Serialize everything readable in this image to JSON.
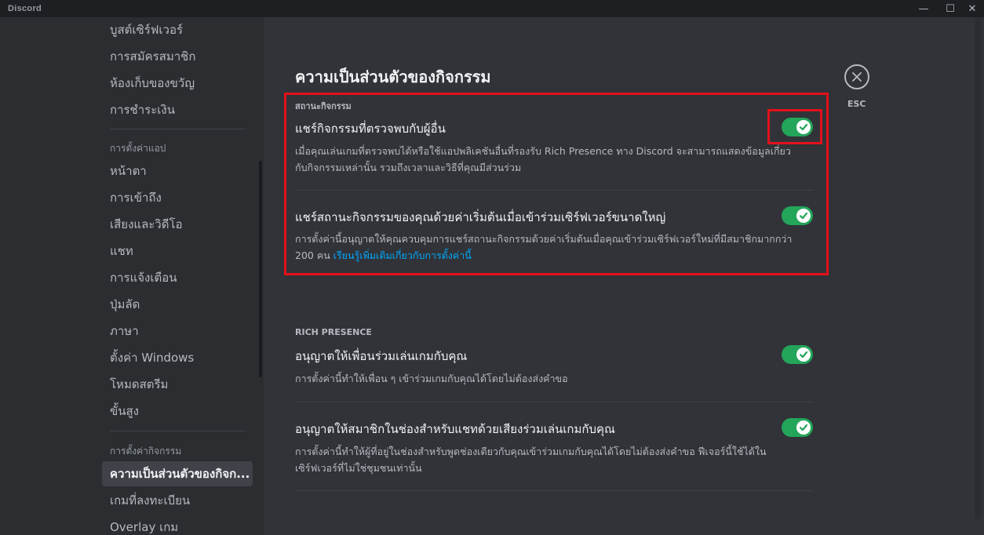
{
  "window": {
    "title": "Discord",
    "controls": {
      "minimize": "—",
      "maximize": "☐",
      "close": "✕"
    }
  },
  "sidebar": {
    "top_items": [
      {
        "label": "บูสต์เซิร์ฟเวอร์"
      },
      {
        "label": "การสมัครสมาชิก"
      },
      {
        "label": "ห้องเก็บของขวัญ"
      },
      {
        "label": "การชำระเงิน"
      }
    ],
    "app_settings_header": "การตั้งค่าแอป",
    "app_items": [
      {
        "label": "หน้าตา"
      },
      {
        "label": "การเข้าถึง"
      },
      {
        "label": "เสียงและวิดีโอ"
      },
      {
        "label": "แชท"
      },
      {
        "label": "การแจ้งเตือน"
      },
      {
        "label": "ปุ่มลัด"
      },
      {
        "label": "ภาษา"
      },
      {
        "label": "ตั้งค่า Windows"
      },
      {
        "label": "โหมดสตรีม"
      },
      {
        "label": "ขั้นสูง"
      }
    ],
    "activity_settings_header": "การตั้งค่ากิจกรรม",
    "activity_items": [
      {
        "label": "ความเป็นส่วนตัวของกิจก...",
        "selected": true
      },
      {
        "label": "เกมที่ลงทะเบียน"
      },
      {
        "label": "Overlay เกม"
      }
    ]
  },
  "main": {
    "title": "ความเป็นส่วนตัวของกิจกรรม",
    "status_section": {
      "header": "สถานะกิจกรรม",
      "settings": [
        {
          "title": "แชร์กิจกรรมที่ตรวจพบกับผู้อื่น",
          "desc_line1": "เมื่อคุณเล่นเกมที่ตรวจพบได้หรือใช้แอปพลิเคชันอื่นที่รองรับ Rich Presence ทาง Discord จะสามารถแสดงข้อมูลเกี่ยว",
          "desc_line2": "กับกิจกรรมเหล่านั้น รวมถึงเวลาและวิธีที่คุณมีส่วนร่วม",
          "enabled": true
        },
        {
          "title": "แชร์สถานะกิจกรรมของคุณด้วยค่าเริ่มต้นเมื่อเข้าร่วมเซิร์ฟเวอร์ขนาดใหญ่",
          "desc_line1": "การตั้งค่านี้อนุญาตให้คุณควบคุมการแชร์สถานะกิจกรรมด้วยค่าเริ่มต้นเมื่อคุณเข้าร่วมเซิร์ฟเวอร์ใหม่ที่มีสมาชิกมากกว่า",
          "desc_line2": "200 คน",
          "link": "เรียนรู้เพิ่มเติมเกี่ยวกับการตั้งค่านี้",
          "enabled": true
        }
      ]
    },
    "rich_presence_section": {
      "header": "RICH PRESENCE",
      "settings": [
        {
          "title": "อนุญาตให้เพื่อนร่วมเล่นเกมกับคุณ",
          "desc_line1": "การตั้งค่านี้ทำให้เพื่อน ๆ เข้าร่วมเกมกับคุณได้โดยไม่ต้องส่งคำขอ",
          "enabled": true
        },
        {
          "title": "อนุญาตให้สมาชิกในช่องสำหรับแชทด้วยเสียงร่วมเล่นเกมกับคุณ",
          "desc_line1": "การตั้งค่านี้ทำให้ผู้ที่อยู่ในช่องสำหรับพูดช่องเดียวกับคุณเข้าร่วมเกมกับคุณได้โดยไม่ต้องส่งคำขอ ฟีเจอร์นี้ใช้ได้ใน",
          "desc_line2": "เซิร์ฟเวอร์ที่ไม่ใช่ชุมชนเท่านั้น",
          "enabled": true
        }
      ]
    },
    "close": {
      "icon": "close-icon",
      "label": "ESC"
    }
  },
  "colors": {
    "background": "#313338",
    "sidebar": "#2b2d31",
    "toggle_on": "#23a55a",
    "highlight": "#e3111b",
    "link": "#00a8fc"
  }
}
